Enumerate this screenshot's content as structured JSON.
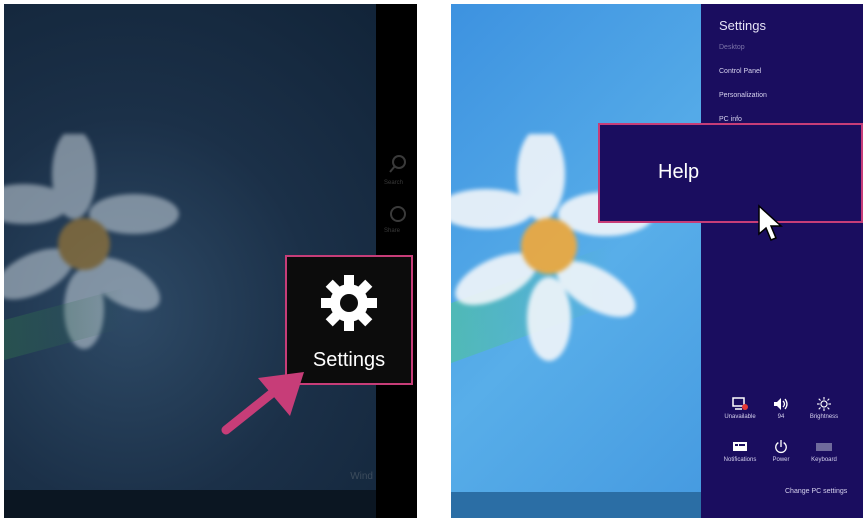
{
  "left_panel": {
    "charms": [
      {
        "icon": "search-icon",
        "label": "Search"
      },
      {
        "icon": "share-icon",
        "label": "Share"
      }
    ],
    "settings_tile": {
      "icon": "gear-icon",
      "label": "Settings"
    },
    "watermark": "Wind"
  },
  "right_panel": {
    "pane_title": "Settings",
    "menu_items": [
      "Desktop",
      "Control Panel",
      "Personalization",
      "PC info"
    ],
    "help_label": "Help",
    "quick_settings": [
      {
        "icon": "network-unavailable-icon",
        "label": "Unavailable"
      },
      {
        "icon": "volume-icon",
        "label": "94"
      },
      {
        "icon": "brightness-icon",
        "label": "Brightness"
      },
      {
        "icon": "notifications-icon",
        "label": "Notifications"
      },
      {
        "icon": "power-icon",
        "label": "Power"
      },
      {
        "icon": "keyboard-icon",
        "label": "Keyboard"
      }
    ],
    "change_pc_settings": "Change PC settings"
  },
  "colors": {
    "highlight_border": "#c73d78",
    "settings_pane_bg": "#1a0d5f",
    "desktop_blue": "#3d92e0"
  }
}
